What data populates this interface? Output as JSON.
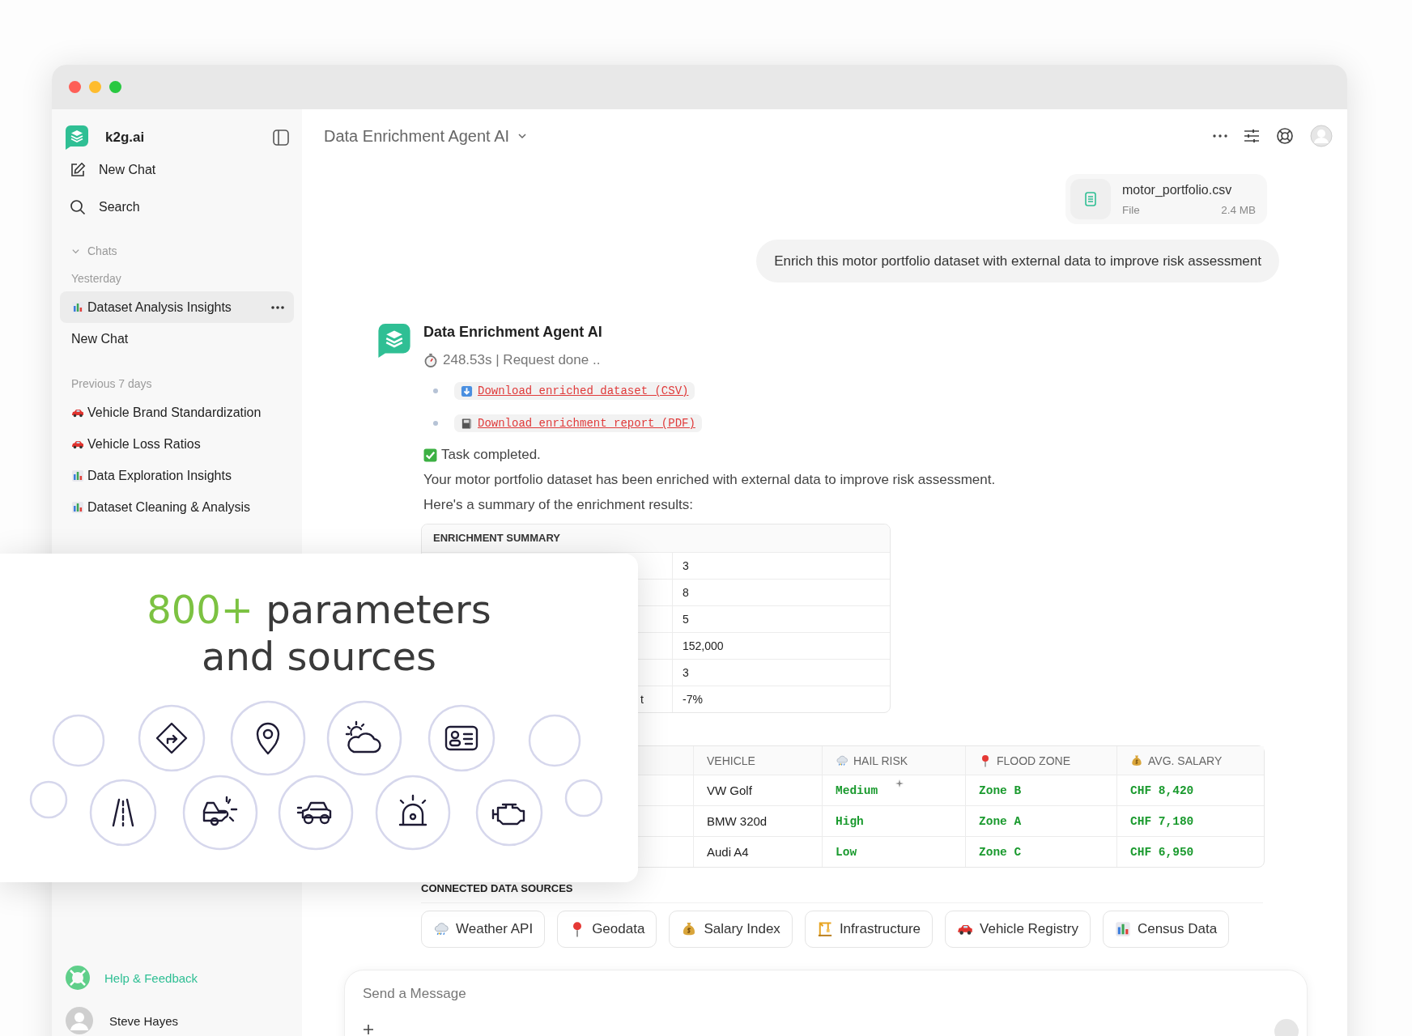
{
  "sidebar": {
    "brand": "k2g.ai",
    "actions": [
      {
        "kind": "edit",
        "label": "New Chat"
      },
      {
        "kind": "search",
        "label": "Search"
      }
    ],
    "section": {
      "label": "Chats",
      "expanded": true
    },
    "groups": [
      {
        "label": "Yesterday",
        "items": [
          {
            "kind": "chart",
            "label": "Dataset Analysis Insights",
            "selected": true
          },
          {
            "label": "New Chat",
            "selected": false
          }
        ]
      },
      {
        "label": "Previous 7 days",
        "items": [
          {
            "kind": "car",
            "label": "Vehicle Brand Standardization",
            "selected": false
          },
          {
            "kind": "car",
            "label": "Vehicle Loss Ratios",
            "selected": false
          },
          {
            "kind": "chart",
            "label": "Data Exploration Insights",
            "selected": false
          },
          {
            "kind": "chart",
            "label": "Dataset Cleaning & Analysis",
            "selected": false
          }
        ]
      }
    ],
    "help": "Help & Feedback",
    "user": "Steve Hayes"
  },
  "header": {
    "title": "Data Enrichment Agent AI"
  },
  "conversation": {
    "attachment": {
      "name": "motor_portfolio.csv",
      "type": "File",
      "size": "2.4 MB"
    },
    "user_message": "Enrich this motor portfolio dataset with external data to improve risk assessment",
    "agent": {
      "name": "Data Enrichment Agent AI",
      "status": "248.53s | Request done ..",
      "links": [
        {
          "kind": "download",
          "label": "Download enriched dataset (CSV)"
        },
        {
          "kind": "book",
          "label": "Download enrichment report (PDF)"
        }
      ],
      "completion": "Task completed.",
      "paragraphs": [
        "Your motor portfolio dataset has been enriched with external data to improve risk assessment.",
        "Here's a summary of the enrichment results:"
      ],
      "summary_table": {
        "title": "ENRICHMENT SUMMARY",
        "rows": [
          {
            "value": "3"
          },
          {
            "value": "8"
          },
          {
            "value": "5"
          },
          {
            "value": "152,000"
          },
          {
            "value": "3"
          },
          {
            "label": "t",
            "value": "-7%"
          }
        ]
      },
      "results_table": {
        "columns": [
          {
            "label": "VEHICLE"
          },
          {
            "kind": "rain",
            "label": "HAIL RISK"
          },
          {
            "kind": "pin",
            "label": "FLOOD ZONE"
          },
          {
            "kind": "money",
            "label": "AVG. SALARY"
          }
        ],
        "rows": [
          [
            "VW Golf",
            "Medium",
            "Zone B",
            "CHF 8,420"
          ],
          [
            "BMW 320d",
            "High",
            "Zone A",
            "CHF 7,180"
          ],
          [
            "Audi A4",
            "Low",
            "Zone C",
            "CHF 6,950"
          ]
        ]
      },
      "sources": {
        "title": "CONNECTED DATA SOURCES",
        "items": [
          {
            "kind": "rain",
            "label": "Weather API"
          },
          {
            "kind": "pin",
            "label": "Geodata"
          },
          {
            "kind": "money",
            "label": "Salary Index"
          },
          {
            "kind": "crane",
            "label": "Infrastructure"
          },
          {
            "kind": "car",
            "label": "Vehicle Registry"
          },
          {
            "kind": "chart",
            "label": "Census Data"
          }
        ]
      }
    }
  },
  "composer": {
    "placeholder": "Send a Message"
  },
  "promo_card": {
    "accent": "800+",
    "lines": [
      "parameters",
      "and sources"
    ]
  }
}
